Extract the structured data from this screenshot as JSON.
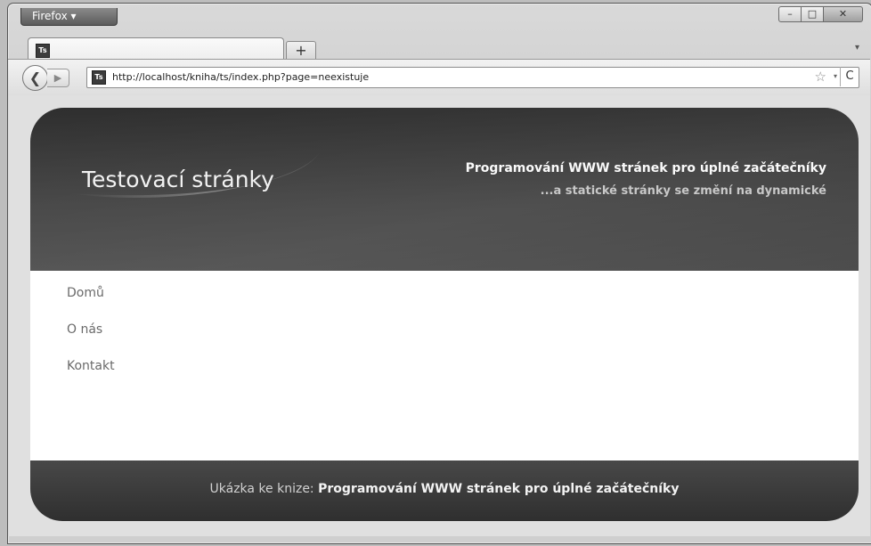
{
  "browser": {
    "menu_button_label": "Firefox ▾",
    "window_controls": {
      "minimize": "–",
      "maximize": "□",
      "close": "✕"
    },
    "tab": {
      "favicon_text": "Ts",
      "title": ""
    },
    "new_tab_label": "+",
    "tab_list_arrow": "▾",
    "back_icon": "❮",
    "forward_icon": "▶",
    "url": "http://localhost/kniha/ts/index.php?page=neexistuje",
    "bookmark_star": "☆",
    "dropdown_arrow": "▾",
    "reload_icon": "C"
  },
  "site": {
    "title": "Testovací stránky",
    "slogan_main": "Programování WWW stránek pro úplné začátečníky",
    "slogan_sub": "...a statické stránky se změní na dynamické",
    "menu": [
      "Domů",
      "O nás",
      "Kontakt"
    ],
    "footer_prefix": "Ukázka ke knize:",
    "footer_book": "Programování WWW stránek pro úplné začátečníky"
  }
}
